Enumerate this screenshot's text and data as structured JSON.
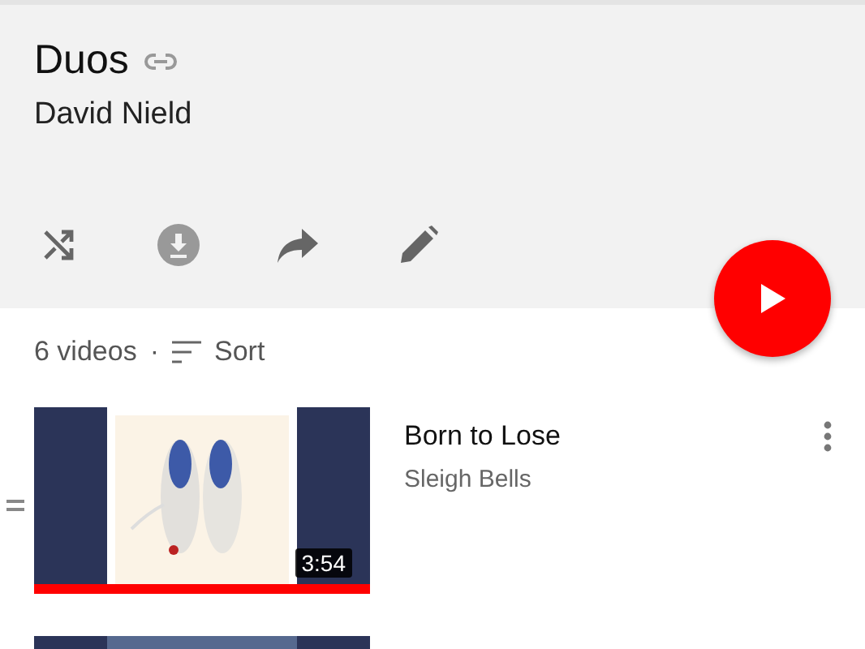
{
  "playlist": {
    "title": "Duos",
    "owner": "David Nield"
  },
  "summary": {
    "count": "6 videos",
    "separator": "·",
    "sort_label": "Sort"
  },
  "videos": [
    {
      "title": "Born to Lose",
      "artist": "Sleigh Bells",
      "duration": "3:54",
      "level": 1
    },
    {
      "kind": "picture"
    }
  ]
}
